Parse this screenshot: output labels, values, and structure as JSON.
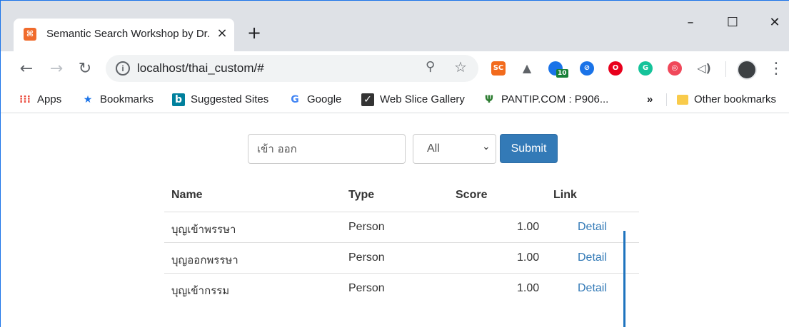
{
  "browser": {
    "tab_title": "Semantic Search Workshop by Dr. Ekapol",
    "tab_favicon": "xampp-icon",
    "url": "localhost/thai_custom/#",
    "window_controls": [
      "minimize-icon",
      "maximize-icon",
      "close-icon"
    ]
  },
  "extensions": [
    {
      "name": "sc-extension-icon",
      "label": "SC",
      "color": "#f26b1d"
    },
    {
      "name": "drive-extension-icon",
      "label": "",
      "color": "#5f6368"
    },
    {
      "name": "people-extension-icon",
      "label": "",
      "badge": "10",
      "color": "#1a73e8"
    },
    {
      "name": "blue-extension-icon",
      "label": "",
      "color": "#1a73e8"
    },
    {
      "name": "opera-extension-icon",
      "label": "O",
      "color": "#e8001c"
    },
    {
      "name": "grammarly-extension-icon",
      "label": "G",
      "color": "#15c39a"
    },
    {
      "name": "red-swirl-extension-icon",
      "label": "",
      "color": "#f0485a"
    },
    {
      "name": "speaker-extension-icon",
      "label": "",
      "color": "#5f6368"
    }
  ],
  "bookmarks": {
    "items": [
      {
        "label": "Apps",
        "icon": "apps-grid-icon"
      },
      {
        "label": "Bookmarks",
        "icon": "star-icon"
      },
      {
        "label": "Suggested Sites",
        "icon": "bing-icon"
      },
      {
        "label": "Google",
        "icon": "google-icon"
      },
      {
        "label": "Web Slice Gallery",
        "icon": "web-slice-icon"
      },
      {
        "label": "PANTIP.COM : P906...",
        "icon": "cactus-icon"
      }
    ],
    "overflow": "»",
    "other": "Other bookmarks"
  },
  "search": {
    "query": "เข้า ออก",
    "type_selected": "All",
    "submit_label": "Submit"
  },
  "results": {
    "headers": [
      "Name",
      "Type",
      "Score",
      "Link"
    ],
    "rows": [
      {
        "name": "บุญเข้าพรรษา",
        "type": "Person",
        "score": "1.00",
        "link": "Detail"
      },
      {
        "name": "บุญออกพรรษา",
        "type": "Person",
        "score": "1.00",
        "link": "Detail"
      },
      {
        "name": "บุญเข้ากรรม",
        "type": "Person",
        "score": "1.00",
        "link": "Detail"
      }
    ]
  }
}
